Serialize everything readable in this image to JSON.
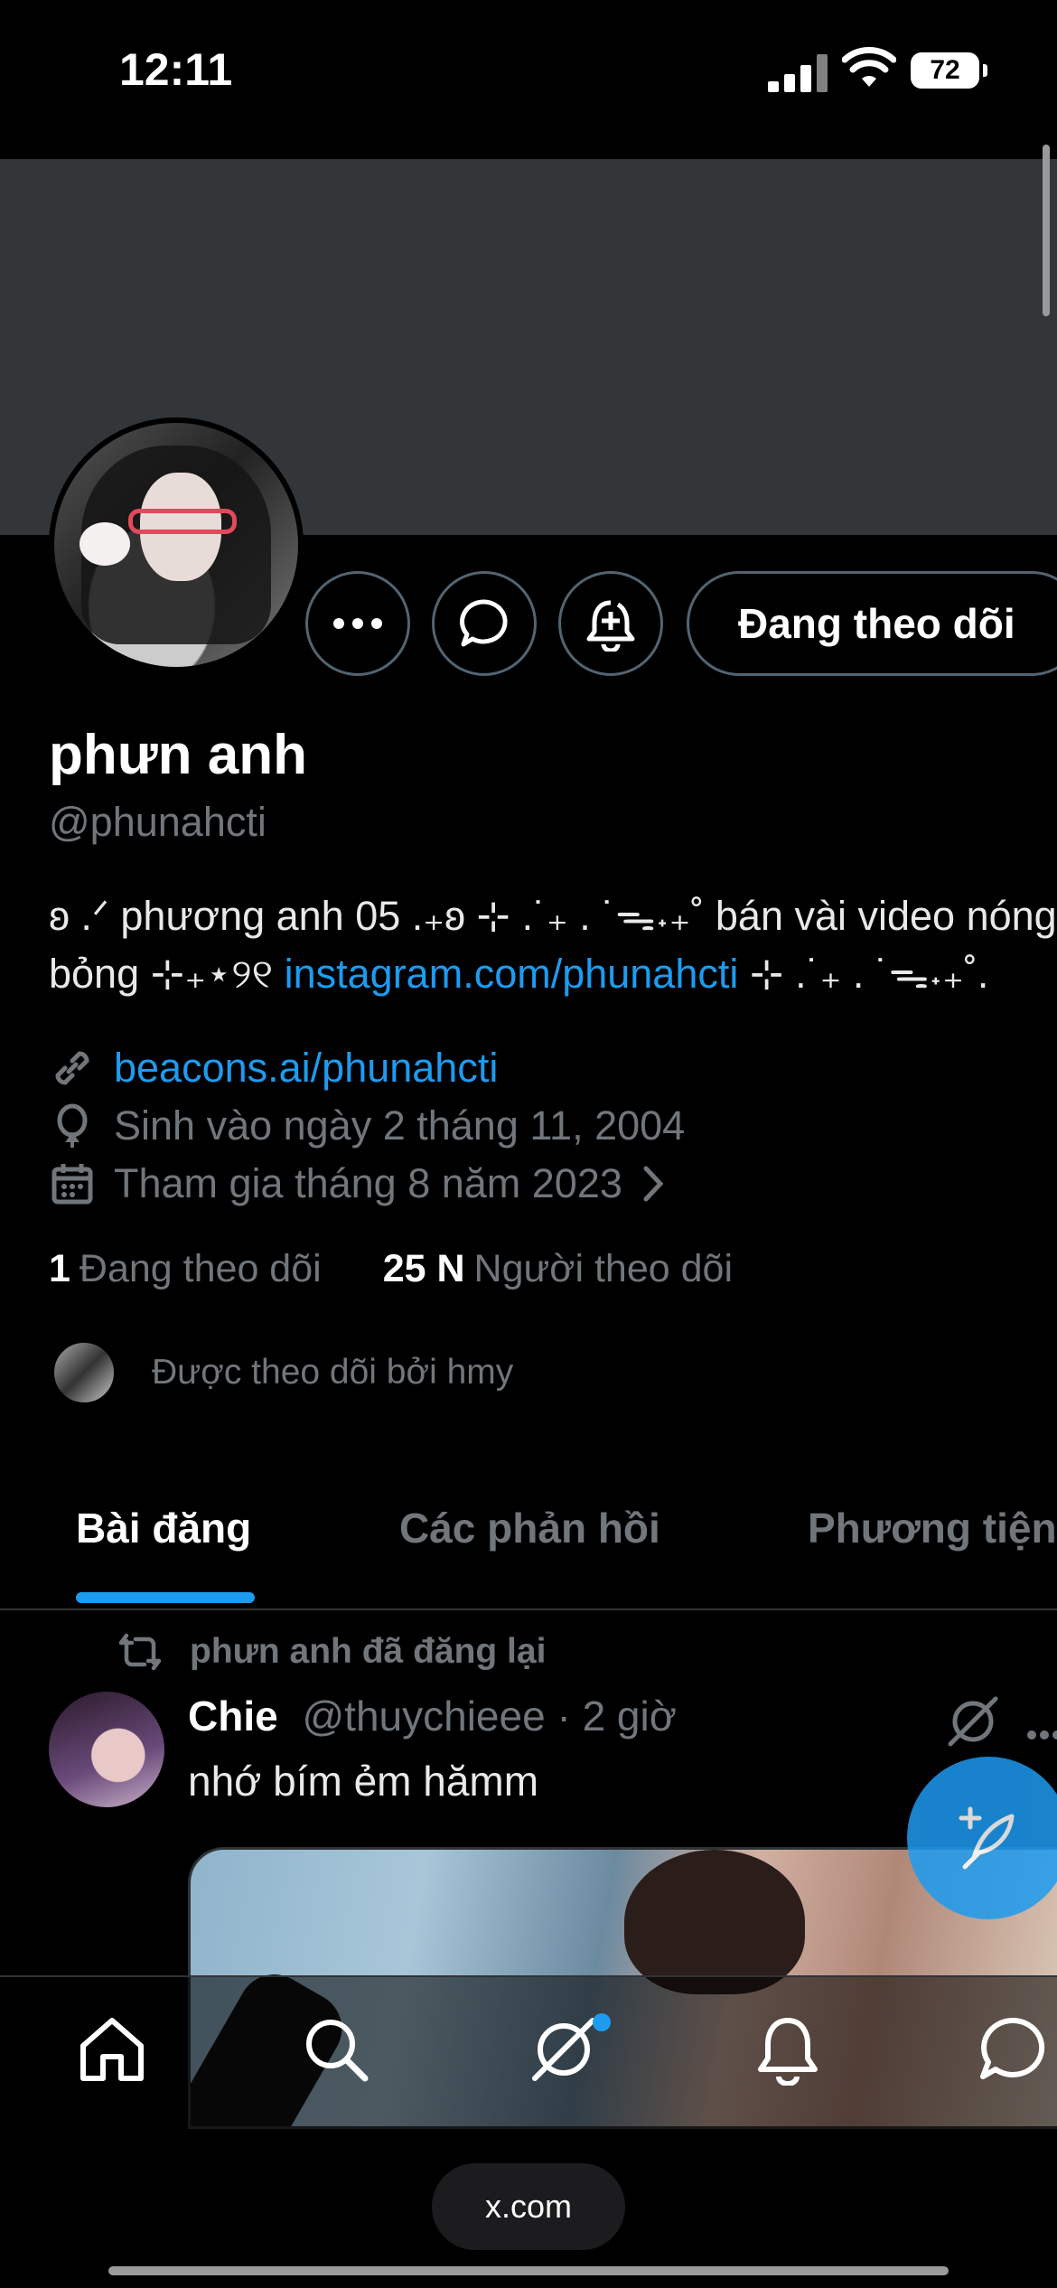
{
  "status_bar": {
    "time": "12:11",
    "battery": "72"
  },
  "profile": {
    "name": "phưn anh",
    "handle": "@phunahcti",
    "follow_button": "Đang theo dõi",
    "bio_prefix": "ʚ .ᐟ phương anh 05 .₊ʚ ⊹ .˙₊ . ˙ᯓ˖₊˚ bán vài video nóng",
    "bio_line2_start": "bỏng ⊹₊⋆୨୧ ",
    "bio_link": "instagram.com/phunahcti",
    "bio_line2_end": " ⊹ .˙₊ . ˙ᯓ˖₊˚.",
    "website": "beacons.ai/phunahcti",
    "birthday": "Sinh vào ngày 2 tháng 11, 2004",
    "joined": "Tham gia tháng 8 năm 2023",
    "following_count": "1",
    "following_label": "Đang theo dõi",
    "followers_count": "25 N",
    "followers_label": "Người theo dõi",
    "followed_by": "Được theo dõi bởi hmy"
  },
  "tabs": [
    "Bài đăng",
    "Các phản hồi",
    "Phương tiện"
  ],
  "active_tab": 0,
  "post": {
    "repost_label": "phưn anh đã đăng lại",
    "author_name": "Chie",
    "author_handle": "@thuychieee",
    "separator": "·",
    "time": "2 giờ",
    "text": "nhớ bím ẻm hămm"
  },
  "browser": {
    "url": "x.com"
  },
  "colors": {
    "accent": "#1d9bf0",
    "background": "#000000",
    "muted": "#71767b",
    "banner": "#333639"
  },
  "icons": [
    "more-icon",
    "message-icon",
    "notify-bell-icon",
    "link-icon",
    "birthday-balloon-icon",
    "calendar-icon",
    "chevron-right-icon",
    "repost-icon",
    "grok-icon",
    "compose-icon",
    "home-icon",
    "search-icon",
    "grok-nav-icon",
    "bell-icon",
    "messages-nav-icon"
  ]
}
